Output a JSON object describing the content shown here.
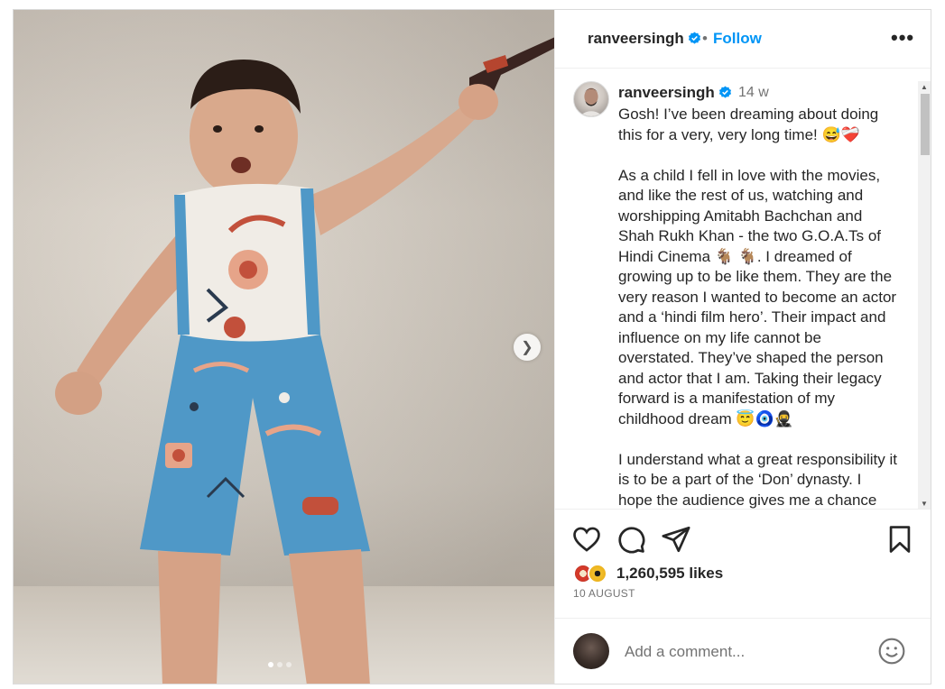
{
  "post": {
    "media": {
      "slide_count": 3,
      "active_slide": 1,
      "next_icon": "chevron-right-icon"
    },
    "header": {
      "username": "ranveersingh",
      "separator": "•",
      "follow_label": "Follow",
      "more_label": "•••"
    },
    "caption": {
      "username": "ranveersingh",
      "time": "14 w",
      "text": "Gosh! I’ve been dreaming about doing this for a very, very long time! 😅❤️‍🩹\n\nAs a child I fell in love with the movies, and like the rest of us, watching and worshipping Amitabh Bachchan and Shah Rukh Khan - the two G.O.A.Ts of Hindi Cinema 🐐 🐐. I dreamed of growing up to be like them. They are the very reason I wanted to become an actor and a ‘hindi film hero’. Their impact and influence on my life cannot be overstated. They’ve shaped the person and actor that I am. Taking their legacy forward is a manifestation of my childhood dream 😇🧿🥷\n\nI understand what a great responsibility it is to be a part of the ‘Don’ dynasty. I hope the audience gives me a chance"
    },
    "actions": {
      "like_icon": "heart-icon",
      "comment_icon": "comment-icon",
      "share_icon": "send-icon",
      "save_icon": "bookmark-icon"
    },
    "likes": "1,260,595 likes",
    "date": "10 AUGUST",
    "comment": {
      "placeholder": "Add a comment...",
      "emoji_icon": "smiley-icon"
    },
    "colors": {
      "accent": "#0095f6",
      "text": "#262626",
      "muted": "#737373",
      "verified": "#0095f6"
    }
  }
}
